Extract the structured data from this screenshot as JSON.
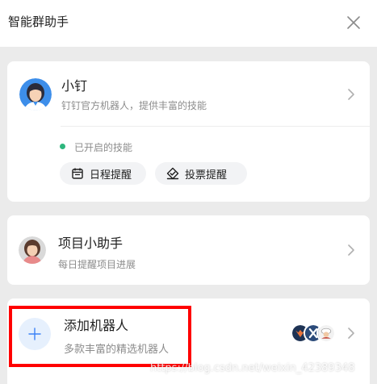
{
  "header": {
    "title": "智能群助手"
  },
  "robots": [
    {
      "name": "小钉",
      "description": "钉钉官方机器人，提供丰富的技能",
      "skills_status": "已开启的技能",
      "skills": [
        {
          "label": "日程提醒",
          "icon": "calendar-icon"
        },
        {
          "label": "投票提醒",
          "icon": "vote-icon"
        }
      ]
    },
    {
      "name": "项目小助手",
      "description": "每日提醒项目进展"
    }
  ],
  "add_robot": {
    "title": "添加机器人",
    "subtitle": "多款丰富的精选机器人"
  },
  "watermark": "https://blog.csdn.net/weixin_42389348",
  "colors": {
    "status_green": "#2eb67d",
    "highlight_red": "#ff0000",
    "add_circle_bg": "#e6f0fd",
    "add_plus": "#3b82f6"
  }
}
